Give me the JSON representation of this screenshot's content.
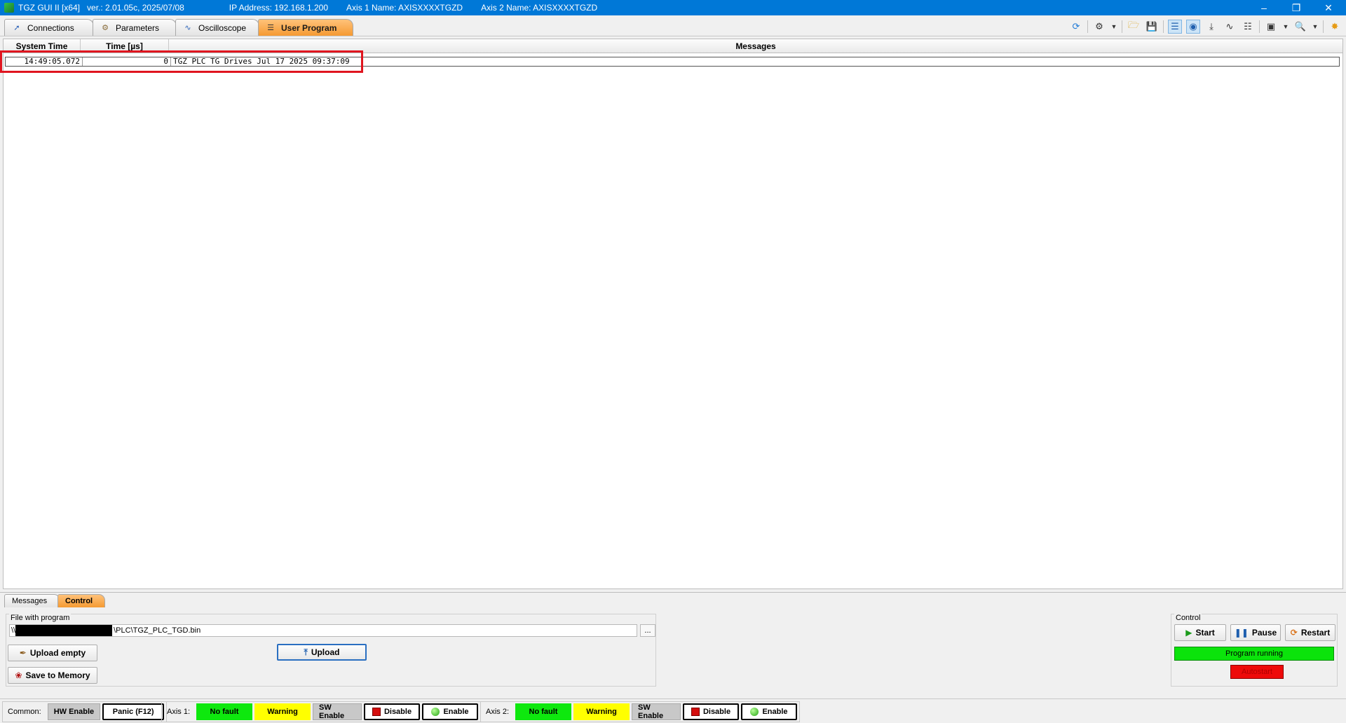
{
  "window": {
    "app_name": "TGZ GUI II [x64]",
    "version": "ver.: 2.01.05c,  2025/07/08",
    "ip_address": "IP Address: 192.168.1.200",
    "axis1_name": "Axis 1 Name: AXISXXXXTGZD",
    "axis2_name": "Axis 2 Name: AXISXXXXTGZD"
  },
  "tabs": [
    {
      "label": "Connections",
      "icon": "plug-icon",
      "active": false
    },
    {
      "label": "Parameters",
      "icon": "gear-icon",
      "active": false
    },
    {
      "label": "Oscilloscope",
      "icon": "waveform-icon",
      "active": false
    },
    {
      "label": "User Program",
      "icon": "program-icon",
      "active": true
    }
  ],
  "grid": {
    "columns": [
      "System Time",
      "Time [µs]",
      "Messages"
    ],
    "rows": [
      {
        "system_time": "14:49:05.072",
        "time_us": "0",
        "message": "TGZ PLC TG Drives Jul 17 2025 09:37:09"
      }
    ]
  },
  "bottom_tabs": [
    {
      "label": "Messages",
      "active": false
    },
    {
      "label": "Control",
      "active": true
    }
  ],
  "file_panel": {
    "legend": "File with program",
    "path_prefix": "\\\\",
    "path_suffix": "\\PLC\\TGZ_PLC_TGD.bin",
    "browse_label": "...",
    "upload_empty": "Upload empty",
    "upload": "Upload",
    "save_to_memory": "Save to Memory"
  },
  "control_panel": {
    "legend": "Control",
    "start": "Start",
    "pause": "Pause",
    "restart": "Restart",
    "status": "Program running",
    "autostart": "Autostart"
  },
  "statusbar": {
    "common_label": "Common:",
    "hw_enable": "HW Enable",
    "panic": "Panic (F12)",
    "axis1_label": "Axis 1:",
    "axis2_label": "Axis 2:",
    "no_fault": "No fault",
    "warning": "Warning",
    "sw_enable": "SW Enable",
    "disable": "Disable",
    "enable": "Enable"
  },
  "colors": {
    "titlebar": "#0078d7",
    "active_tab": "#f59a32",
    "highlight": "#e0151f",
    "ok_green": "#0ee80e",
    "warning_yellow": "#ffff00",
    "error_red": "#ee0a0a"
  }
}
